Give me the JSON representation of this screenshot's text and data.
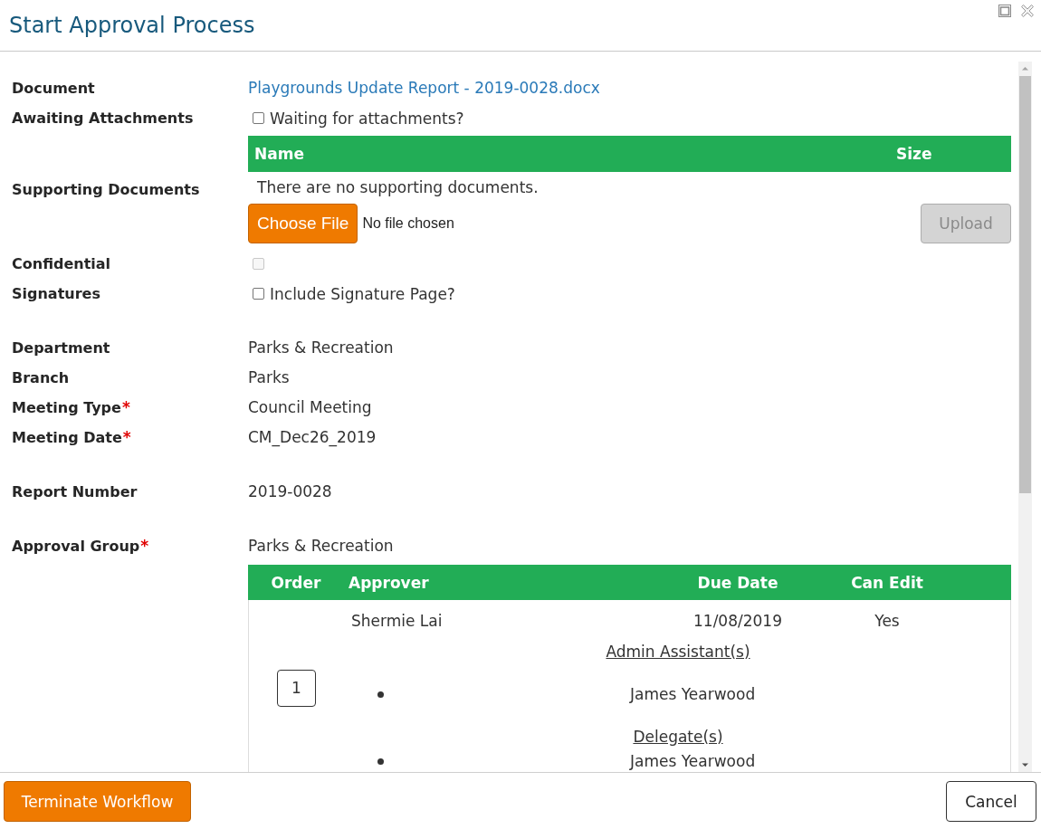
{
  "window": {
    "title": "Start Approval Process"
  },
  "sections": [
    {
      "fields": [
        {
          "kind": "link",
          "label": "Document",
          "value": "Playgrounds Update Report - 2019-0028.docx"
        },
        {
          "kind": "checkbox",
          "label": "Awaiting Attachments",
          "checkbox": {
            "text": "Waiting for attachments?",
            "checked": false,
            "disabled": false
          }
        },
        {
          "kind": "attachments",
          "label": "Supporting Documents",
          "columns": [
            "Name",
            "Size"
          ],
          "empty_message": "There are no supporting documents.",
          "choose_file": "Choose File",
          "file_status": "No file chosen",
          "upload": {
            "label": "Upload",
            "disabled": true
          }
        },
        {
          "kind": "checkbox",
          "label": "Confidential",
          "checkbox": {
            "checked": false,
            "disabled": true
          }
        },
        {
          "kind": "checkbox",
          "label": "Signatures",
          "checkbox": {
            "text": "Include Signature Page?",
            "checked": false,
            "disabled": false
          }
        }
      ]
    },
    {
      "fields": [
        {
          "kind": "text",
          "label": "Department",
          "value": "Parks & Recreation"
        },
        {
          "kind": "text",
          "label": "Branch",
          "value": "Parks"
        },
        {
          "kind": "text",
          "label": "Meeting Type",
          "required_mark": "*",
          "value": "Council Meeting"
        },
        {
          "kind": "text",
          "label": "Meeting Date",
          "required_mark": "*",
          "value": "CM_Dec26_2019"
        }
      ]
    },
    {
      "fields": [
        {
          "kind": "text",
          "label": "Report Number",
          "value": "2019-0028"
        }
      ]
    },
    {
      "fields": [
        {
          "kind": "approval",
          "label": "Approval Group",
          "required_mark": "*",
          "value": "Parks & Recreation",
          "table": {
            "columns": [
              "Order",
              "Approver",
              "Due Date",
              "Can Edit"
            ],
            "rows": [
              {
                "order": "1",
                "approver": "Shermie Lai",
                "due_date": "11/08/2019",
                "can_edit": "Yes",
                "groups": [
                  {
                    "heading": "Admin Assistant(s)",
                    "names": [
                      "James Yearwood"
                    ]
                  },
                  {
                    "heading": "Delegate(s)",
                    "names": [
                      "James Yearwood"
                    ]
                  }
                ]
              }
            ]
          }
        }
      ]
    }
  ],
  "footer": {
    "buttons": [
      {
        "label": "Terminate Workflow",
        "kind": "danger"
      },
      {
        "label": "Cancel",
        "kind": "secondary"
      }
    ]
  }
}
